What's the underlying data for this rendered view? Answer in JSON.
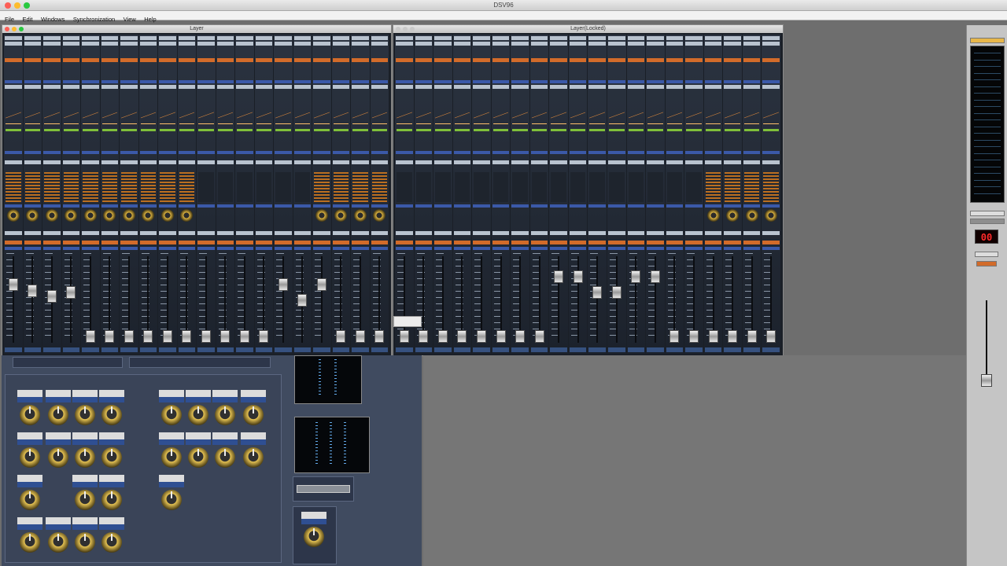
{
  "app": {
    "title": "DSV96"
  },
  "menu": [
    "File",
    "Edit",
    "Windows",
    "Synchronization",
    "View",
    "Help"
  ],
  "windows": {
    "left": {
      "title": "Layer"
    },
    "right": {
      "title": "Layer(Locked)"
    }
  },
  "right_meter": {
    "display": "00"
  },
  "colors": {
    "accent": "#e0b640",
    "meter": "#d67b1d",
    "panel": "#404b60",
    "window_bg": "#1a1f27"
  }
}
